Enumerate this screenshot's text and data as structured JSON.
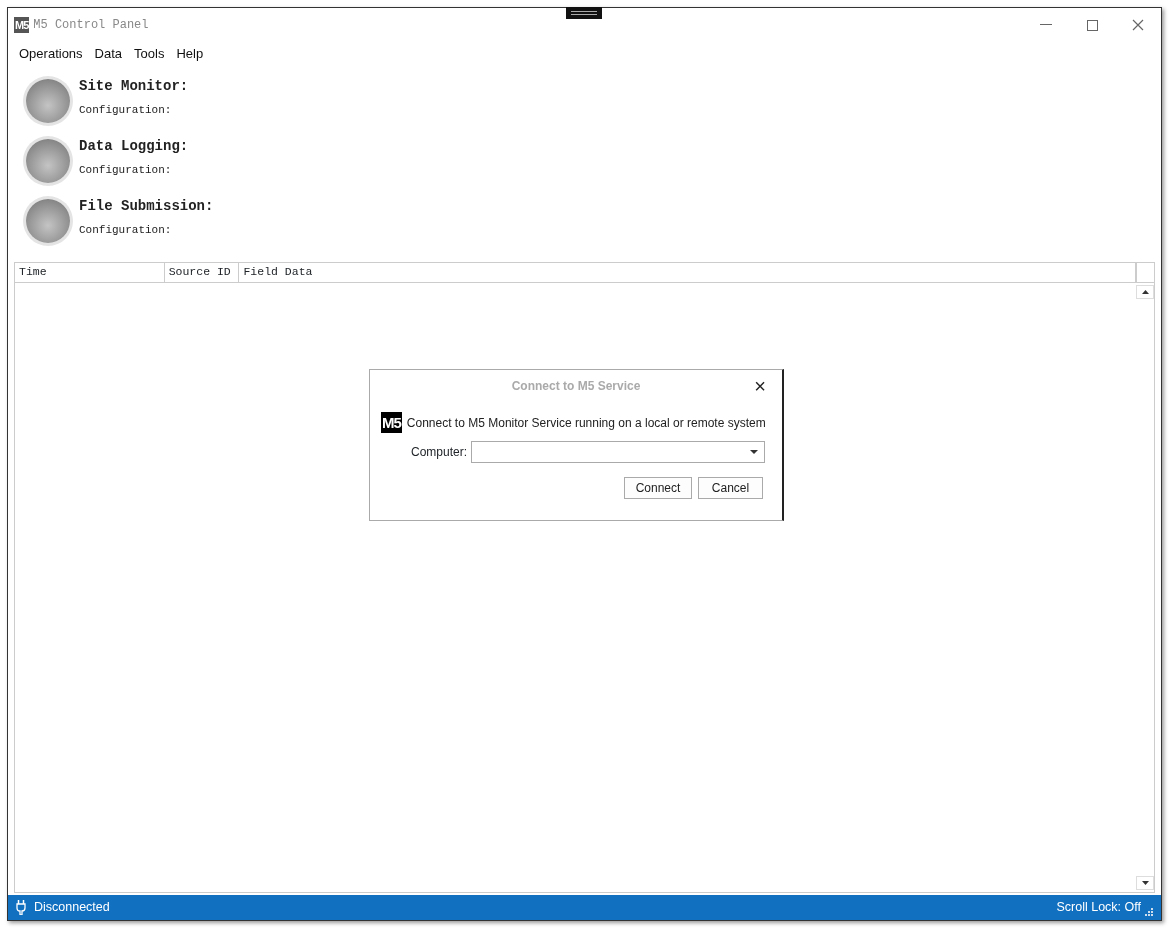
{
  "window": {
    "logo": "M5",
    "title": "M5 Control Panel"
  },
  "menu": [
    "Operations",
    "Data",
    "Tools",
    "Help"
  ],
  "monitors": [
    {
      "name": "Site Monitor:",
      "detail": "Configuration:",
      "on": false
    },
    {
      "name": "Data Logging:",
      "detail": "Configuration:",
      "on": false
    },
    {
      "name": "File Submission:",
      "detail": "Configuration:",
      "on": false
    }
  ],
  "table": {
    "columns": [
      "Time",
      "Source ID",
      "Field Data"
    ]
  },
  "dialog": {
    "title": "Connect to M5 Service",
    "close": "×",
    "logo": "M5",
    "message": "Connect to M5 Monitor Service running on a local or remote system",
    "field_label": "Computer:",
    "buttons": [
      "Connect",
      "Cancel"
    ]
  },
  "status_bar": {
    "connection": "Disconnected",
    "scroll_lock": "Scroll Lock: Off"
  }
}
